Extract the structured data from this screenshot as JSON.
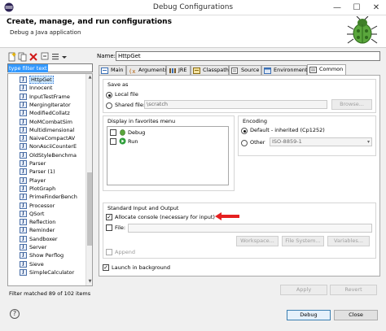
{
  "window": {
    "title": "Debug Configurations",
    "controls": {
      "minimize": "—",
      "maximize": "☐",
      "close": "✕"
    }
  },
  "header": {
    "title": "Create, manage, and run configurations",
    "subtitle": "Debug a Java application"
  },
  "left_panel": {
    "filter_placeholder": "type filter text",
    "items": [
      "HttpGet",
      "Innocent",
      "InputTestFrame",
      "MergingIterator",
      "ModifiedCollatz",
      "MoMCombatSim",
      "Multidimensional",
      "NaiveCompactAV",
      "NonAsciiCounterE",
      "OldStyleBenchma",
      "Parser",
      "Parser (1)",
      "Player",
      "PlotGraph",
      "PrimeFinderBench",
      "Processor",
      "QSort",
      "Reflection",
      "Reminder",
      "Sandboxer",
      "Server",
      "Show Perflog",
      "Sieve",
      "SimpleCalculator"
    ],
    "selected_index": 0,
    "status": "Filter matched 89 of 102 items"
  },
  "name": {
    "label": "Name:",
    "value": "HttpGet"
  },
  "tabs": [
    {
      "label": "Main"
    },
    {
      "label": "Arguments"
    },
    {
      "label": "JRE"
    },
    {
      "label": "Classpath"
    },
    {
      "label": "Source"
    },
    {
      "label": "Environment"
    },
    {
      "label": "Common"
    }
  ],
  "active_tab": "Common",
  "save_as": {
    "title": "Save as",
    "local_file": "Local file",
    "shared_file": "Shared file:",
    "shared_path": "\\scratch",
    "browse": "Browse..."
  },
  "favorites": {
    "title": "Display in favorites menu",
    "items": [
      {
        "label": "Debug",
        "checked": false
      },
      {
        "label": "Run",
        "checked": false
      }
    ]
  },
  "encoding": {
    "title": "Encoding",
    "default": "Default - inherited (Cp1252)",
    "other": "Other",
    "other_value": "ISO-8859-1"
  },
  "std_io": {
    "title": "Standard Input and Output",
    "allocate_console": "Allocate console (necessary for input)",
    "file": "File:",
    "workspace": "Workspace...",
    "file_system": "File System...",
    "variables": "Variables...",
    "append": "Append"
  },
  "launch_background": "Launch in background",
  "actions": {
    "apply": "Apply",
    "revert": "Revert"
  },
  "footer": {
    "help": "?",
    "debug": "Debug",
    "close": "Close"
  },
  "colors": {
    "accent": "#3399ff",
    "arrow": "#e52020",
    "run_icon": "#2e9e3a"
  }
}
